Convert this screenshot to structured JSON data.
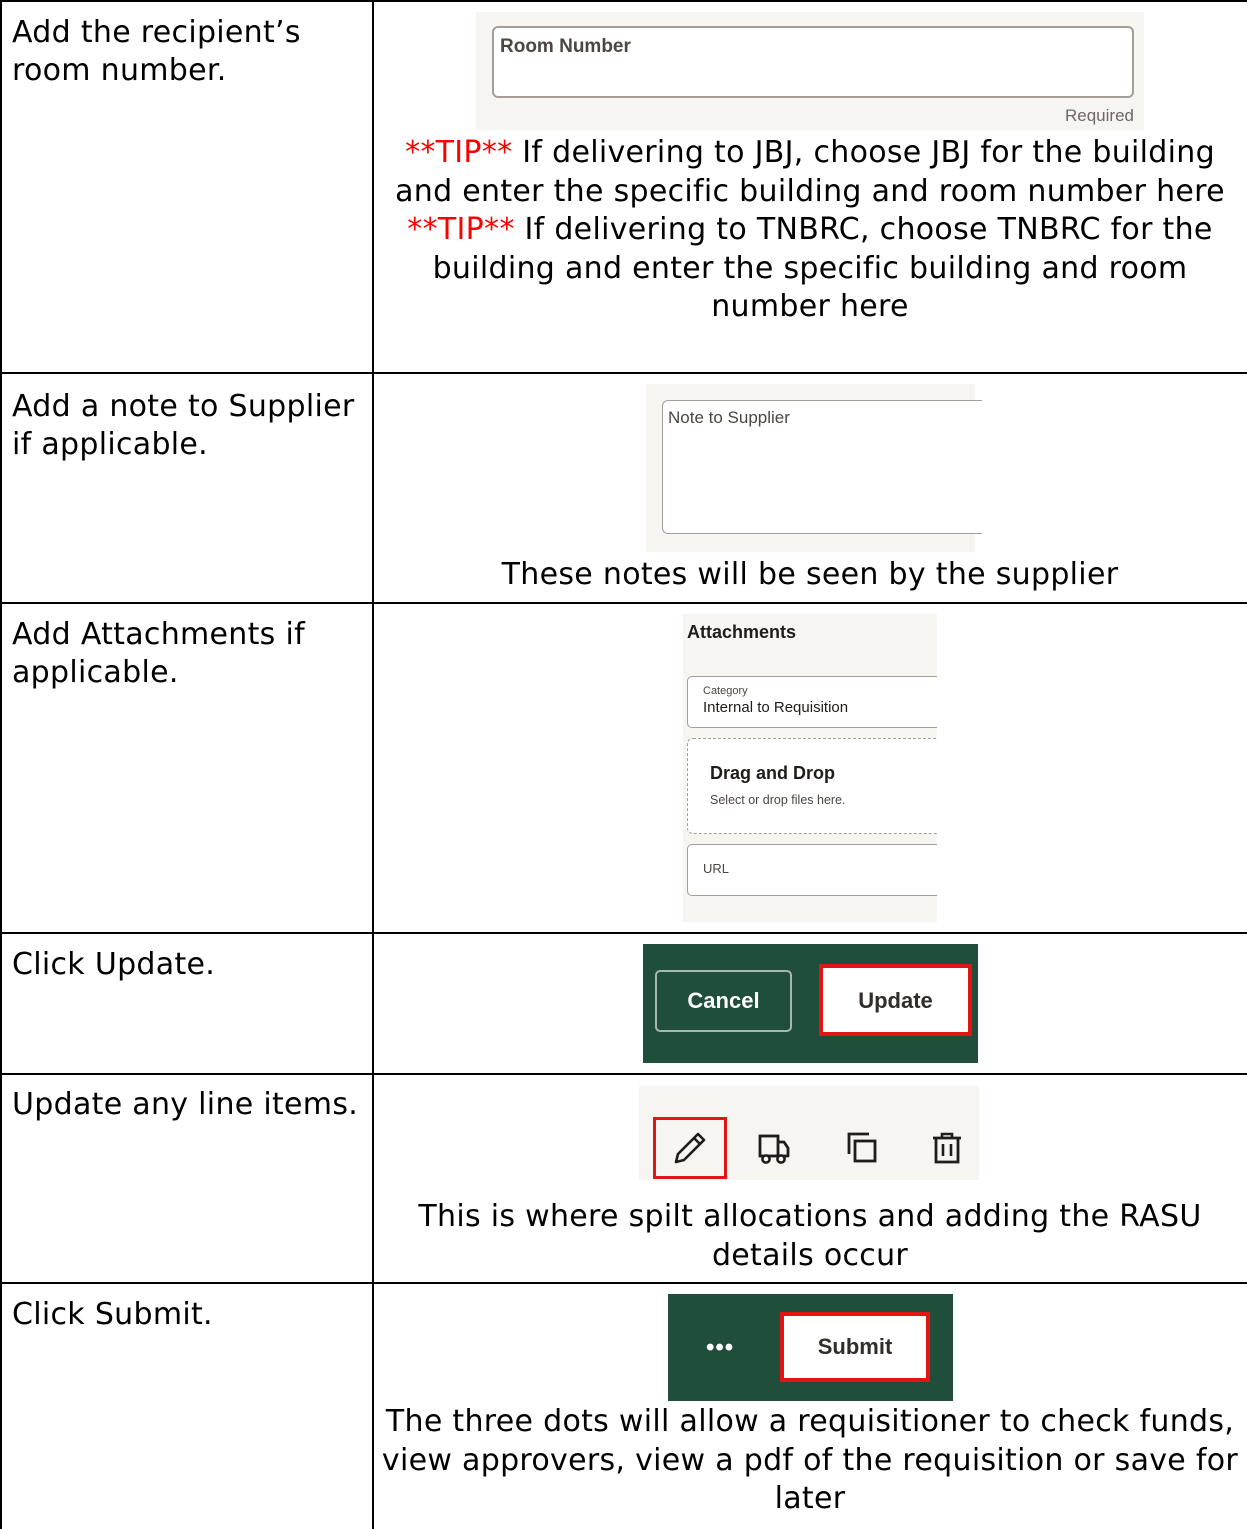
{
  "rows": [
    {
      "step": "Add the recipient’s room number.",
      "screenshot": {
        "field_label": "Room Number",
        "required_label": "Required"
      },
      "caption": [
        {
          "tip": "**TIP**",
          "text": " If delivering to JBJ, choose JBJ for the building and enter the specific building and room number here"
        },
        {
          "tip": "**TIP**",
          "text": " If delivering to TNBRC, choose TNBRC for the building and enter the specific building and room number here"
        }
      ]
    },
    {
      "step": "Add a note to Supplier if applicable.",
      "screenshot": {
        "field_label": "Note to Supplier"
      },
      "caption": "These notes will be seen by the supplier"
    },
    {
      "step": "Add Attachments if applicable.",
      "screenshot": {
        "title": "Attachments",
        "category_label": "Category",
        "category_value": "Internal to Requisition",
        "drop_title": "Drag and Drop",
        "drop_subtitle": "Select or drop files here.",
        "url_label": "URL"
      }
    },
    {
      "step": "Click Update.",
      "screenshot": {
        "cancel_label": "Cancel",
        "update_label": "Update"
      }
    },
    {
      "step": "Update any line items.",
      "screenshot": {
        "icons": [
          "pencil-icon",
          "truck-icon",
          "copy-icon",
          "trash-icon"
        ]
      },
      "caption": "This is where spilt allocations and adding the RASU details occur"
    },
    {
      "step": "Click Submit.",
      "screenshot": {
        "more_label": "•••",
        "submit_label": "Submit"
      },
      "caption": "The three dots will allow a requisitioner to check funds, view approvers, view a pdf of the requisition or save for later"
    }
  ],
  "colors": {
    "tip": "#ff0000",
    "highlight": "#e01515",
    "header_green": "#1f4e3a"
  }
}
